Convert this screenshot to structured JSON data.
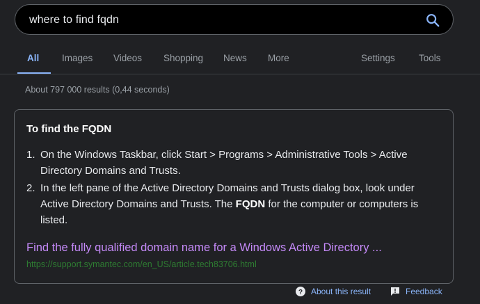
{
  "search": {
    "query": "where to find fqdn",
    "icon": "search-icon"
  },
  "tabs": {
    "all": "All",
    "images": "Images",
    "videos": "Videos",
    "shopping": "Shopping",
    "news": "News",
    "more": "More",
    "settings": "Settings",
    "tools": "Tools"
  },
  "stats": "About 797 000 results (0,44 seconds)",
  "featured_snippet": {
    "title_prefix": "To find the ",
    "title_bold": "FQDN",
    "steps": [
      {
        "number": "1.",
        "text": "On the Windows Taskbar, click Start > Programs > Administrative Tools > Active Directory Domains and Trusts."
      },
      {
        "number": "2.",
        "text_before": "In the left pane of the Active Directory Domains and Trusts dialog box, look under Active Directory Domains and Trusts. The ",
        "text_bold": "FQDN",
        "text_after": " for the computer or computers is listed."
      }
    ],
    "link_title": "Find the fully qualified domain name for a Windows Active Directory ...",
    "link_url": "https://support.symantec.com/en_US/article.tech83706.html"
  },
  "footer": {
    "about": "About this result",
    "about_icon": "help-circle-icon",
    "feedback": "Feedback",
    "feedback_icon": "feedback-icon"
  },
  "colors": {
    "background": "#202124",
    "accent": "#8ab4f8",
    "visited_link": "#c58af9",
    "url_green": "#2e7d32"
  }
}
